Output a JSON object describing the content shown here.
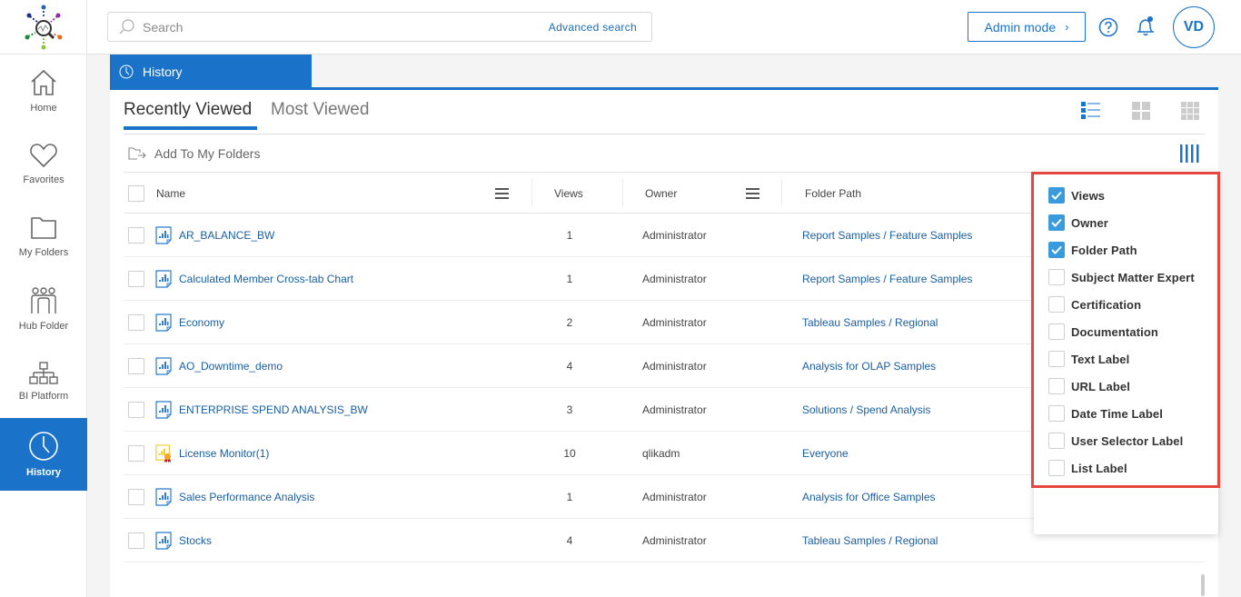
{
  "sidebar": {
    "items": [
      {
        "label": "Home",
        "icon": "home-icon",
        "active": false
      },
      {
        "label": "Favorites",
        "icon": "heart-icon",
        "active": false
      },
      {
        "label": "My Folders",
        "icon": "folder-icon",
        "active": false
      },
      {
        "label": "Hub Folder",
        "icon": "users-icon",
        "active": false
      },
      {
        "label": "BI Platform",
        "icon": "hierarchy-icon",
        "active": false
      },
      {
        "label": "History",
        "icon": "clock-icon",
        "active": true
      }
    ]
  },
  "topbar": {
    "search_placeholder": "Search",
    "advanced_search": "Advanced search",
    "admin_mode": "Admin mode",
    "admin_chevron": "›",
    "avatar_initials": "VD"
  },
  "page": {
    "section_tab": "History",
    "tabs": [
      {
        "label": "Recently Viewed",
        "active": true
      },
      {
        "label": "Most Viewed",
        "active": false
      }
    ],
    "add_to_folders": "Add To My Folders"
  },
  "table": {
    "columns": {
      "name": "Name",
      "views": "Views",
      "owner": "Owner",
      "folder_path": "Folder Path"
    },
    "rows": [
      {
        "name": "AR_BALANCE_BW",
        "views": "1",
        "owner": "Administrator",
        "path": "Report Samples / Feature Samples",
        "icon": "report-icon"
      },
      {
        "name": "Calculated Member Cross-tab Chart",
        "views": "1",
        "owner": "Administrator",
        "path": "Report Samples / Feature Samples",
        "icon": "report-icon"
      },
      {
        "name": "Economy",
        "views": "2",
        "owner": "Administrator",
        "path": "Tableau Samples / Regional",
        "icon": "report-icon"
      },
      {
        "name": "AO_Downtime_demo",
        "views": "4",
        "owner": "Administrator",
        "path": "Analysis for OLAP Samples",
        "icon": "report-icon"
      },
      {
        "name": "ENTERPRISE SPEND ANALYSIS_BW",
        "views": "3",
        "owner": "Administrator",
        "path": "Solutions / Spend Analysis",
        "icon": "report-icon"
      },
      {
        "name": "License Monitor(1)",
        "views": "10",
        "owner": "qlikadm",
        "path": "Everyone",
        "icon": "certified-report-icon"
      },
      {
        "name": "Sales Performance Analysis",
        "views": "1",
        "owner": "Administrator",
        "path": "Analysis for Office Samples",
        "icon": "report-icon"
      },
      {
        "name": "Stocks",
        "views": "4",
        "owner": "Administrator",
        "path": "Tableau Samples / Regional",
        "icon": "report-icon"
      }
    ]
  },
  "column_chooser": {
    "options": [
      {
        "label": "Views",
        "checked": true
      },
      {
        "label": "Owner",
        "checked": true
      },
      {
        "label": "Folder Path",
        "checked": true
      },
      {
        "label": "Subject Matter Expert",
        "checked": false
      },
      {
        "label": "Certification",
        "checked": false
      },
      {
        "label": "Documentation",
        "checked": false
      },
      {
        "label": "Text Label",
        "checked": false
      },
      {
        "label": "URL Label",
        "checked": false
      },
      {
        "label": "Date Time Label",
        "checked": false
      },
      {
        "label": "User Selector Label",
        "checked": false
      },
      {
        "label": "List Label",
        "checked": false
      }
    ]
  },
  "colors": {
    "accent": "#1a73c9",
    "link": "#1a5fa3",
    "checkbox_on": "#3a9bdc",
    "highlight": "#e5463e"
  }
}
